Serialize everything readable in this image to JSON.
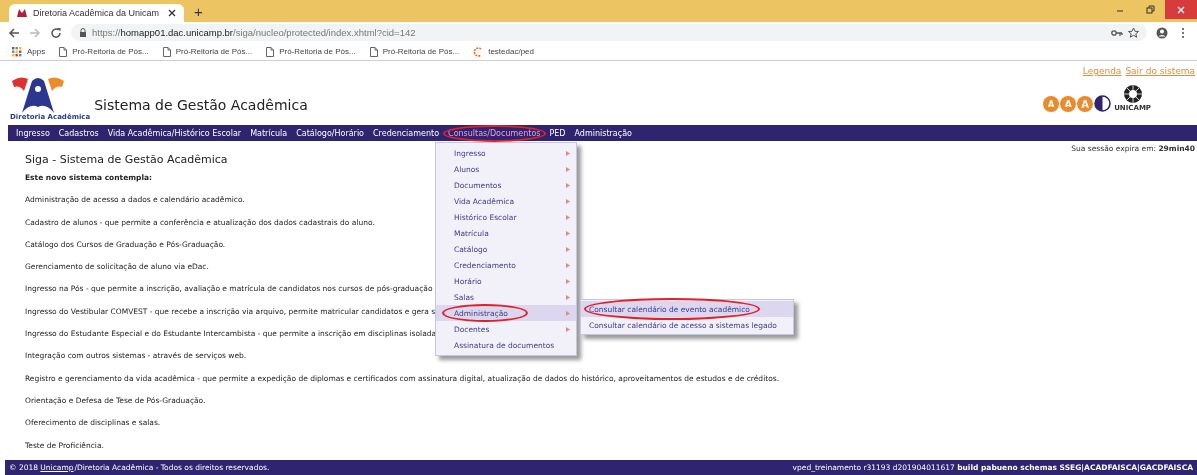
{
  "browser": {
    "tabs": [
      {
        "title": "Diretoria Acadêmica da Unicam",
        "selected": true
      }
    ],
    "new_tab": "+",
    "url": {
      "scheme": "https://",
      "host": "homapp01.dac.unicamp.br",
      "path": "/siga/nucleo/protected/index.xhtml?cid=142"
    },
    "bookmarks": [
      {
        "kind": "apps",
        "label": "Apps"
      },
      {
        "kind": "page",
        "label": "Pró-Reitoria de Pós..."
      },
      {
        "kind": "page",
        "label": "Pró-Reitoria de Pós..."
      },
      {
        "kind": "page",
        "label": "Pró-Reitoria de Pós..."
      },
      {
        "kind": "page",
        "label": "Pró-Reitoria de Pós..."
      },
      {
        "kind": "site",
        "label": "testedac/ped"
      }
    ]
  },
  "header": {
    "title": "Sistema de Gestão Acadêmica",
    "logo_caption": "Diretoria Acadêmica",
    "links": [
      "Legenda",
      "Sair do sistema"
    ],
    "font_size_buttons": [
      "A",
      "A",
      "A"
    ],
    "university_caption": "UNICAMP"
  },
  "nav": [
    {
      "label": "Ingresso",
      "selected": false,
      "circled": false
    },
    {
      "label": "Cadastros",
      "selected": false,
      "circled": false
    },
    {
      "label": "Vida Acadêmica/Histórico Escolar",
      "selected": false,
      "circled": false
    },
    {
      "label": "Matrícula",
      "selected": false,
      "circled": false
    },
    {
      "label": "Catálogo/Horário",
      "selected": false,
      "circled": false
    },
    {
      "label": "Credenciamento",
      "selected": false,
      "circled": false
    },
    {
      "label": "Consultas/Documentos",
      "selected": true,
      "circled": true
    },
    {
      "label": "PED",
      "selected": false,
      "circled": false
    },
    {
      "label": "Administração",
      "selected": false,
      "circled": false
    }
  ],
  "menu": [
    {
      "label": "Ingresso",
      "has_submenu": true,
      "selected": false,
      "circled": false
    },
    {
      "label": "Alunos",
      "has_submenu": true,
      "selected": false,
      "circled": false
    },
    {
      "label": "Documentos",
      "has_submenu": true,
      "selected": false,
      "circled": false
    },
    {
      "label": "Vida Acadêmica",
      "has_submenu": true,
      "selected": false,
      "circled": false
    },
    {
      "label": "Histórico Escolar",
      "has_submenu": true,
      "selected": false,
      "circled": false
    },
    {
      "label": "Matrícula",
      "has_submenu": true,
      "selected": false,
      "circled": false
    },
    {
      "label": "Catálogo",
      "has_submenu": true,
      "selected": false,
      "circled": false
    },
    {
      "label": "Credenciamento",
      "has_submenu": true,
      "selected": false,
      "circled": false
    },
    {
      "label": "Horário",
      "has_submenu": true,
      "selected": false,
      "circled": false
    },
    {
      "label": "Salas",
      "has_submenu": true,
      "selected": false,
      "circled": false
    },
    {
      "label": "Administração",
      "has_submenu": true,
      "selected": true,
      "circled": true
    },
    {
      "label": "Docentes",
      "has_submenu": true,
      "selected": false,
      "circled": false
    },
    {
      "label": "Assinatura de documentos",
      "has_submenu": false,
      "selected": false,
      "circled": false
    }
  ],
  "submenu": [
    {
      "label": "Consultar calendário de evento acadêmico",
      "selected": true,
      "circled": true
    },
    {
      "label": "Consultar calendário de acesso a sistemas legado",
      "selected": false,
      "circled": false
    }
  ],
  "session": "Sua sessão expira em: **29min40**",
  "content": {
    "title": "Siga - Sistema de Gestão Acadêmica",
    "intro": "Este novo sistema contempla:",
    "paragraphs": [
      "Administração de acesso a dados e calendário acadêmico.",
      "Cadastro de alunos - que permite a conferência e atualização dos dados cadastrais do aluno.",
      "Catálogo dos Cursos de Graduação e Pós-Graduação.",
      "Gerenciamento de solicitação de aluno via eDac.",
      "Ingresso na Pós - que permite a inscrição, avaliação e matrícula de candidatos nos cursos de pós-graduação",
      "Ingresso do Vestibular COMVEST - que recebe a inscrição via arquivo, permite matricular candidatos e gera s",
      "Ingresso do Estudante Especial e do Estudante Intercambista - que permite a inscrição em disciplinas isolada",
      "Integração com outros sistemas - através de serviços web.",
      "Registro e gerenciamento da vida acadêmica - que permite a expedição de diplomas e certificados com assinatura digital, atualização de dados do histórico, aproveitamentos de estudos e de créditos.",
      "Orientação e Defesa de Tese de Pós-Graduação.",
      "Oferecimento de disciplinas e salas.",
      "Teste de Proficiência."
    ]
  },
  "footer": {
    "copyright_before": "© 2018",
    "link": "Unicamp",
    "copyright_after": "/Diretoria Acadêmica - Todos os direitos reservados.",
    "build": "vped_treinamento r31193 d201904011617 **build pabueno schemas SSEG|ACADFAISCA|GACDFAISCA**"
  }
}
